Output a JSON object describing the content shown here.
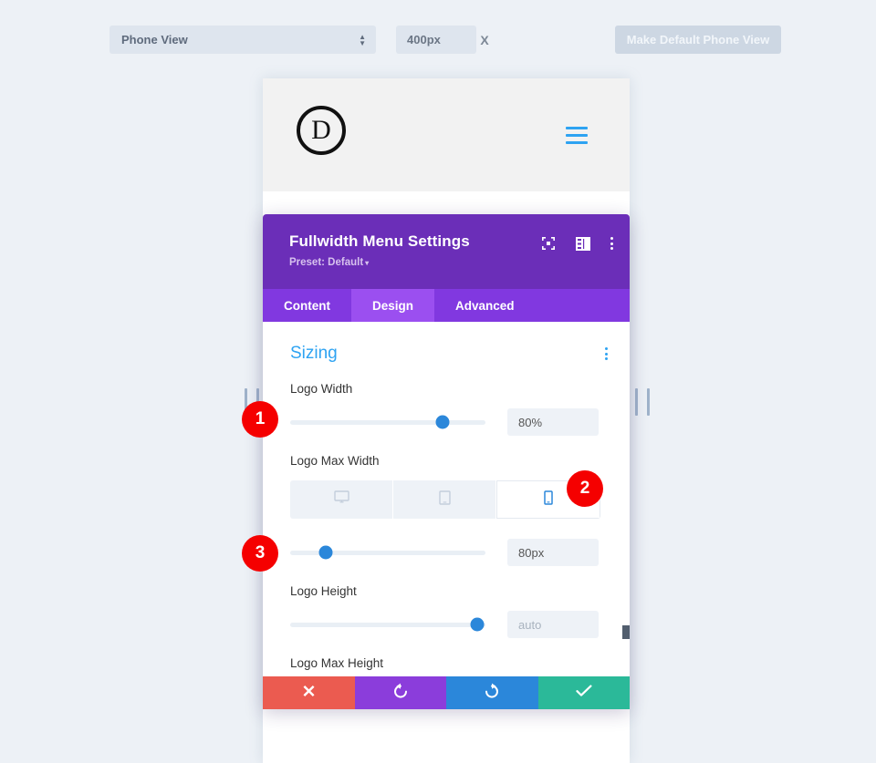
{
  "toolbar": {
    "view_select_value": "Phone View",
    "view_select_icon": "spinner-arrows-icon",
    "width_value": "400px",
    "height_value": "",
    "height_placeholder": "",
    "separator": "X",
    "make_default_label": "Make Default Phone View"
  },
  "preview": {
    "logo_letter": "D",
    "logo_icon": "divi-logo-icon",
    "menu_icon": "hamburger-menu-icon"
  },
  "modal": {
    "title": "Fullwidth Menu Settings",
    "preset_label": "Preset: Default",
    "preset_caret": "▾",
    "header_icons": [
      {
        "name": "expand-fullscreen-icon"
      },
      {
        "name": "panel-layout-icon"
      },
      {
        "name": "more-options-icon"
      }
    ],
    "tabs": [
      {
        "label": "Content",
        "active": false
      },
      {
        "label": "Design",
        "active": true
      },
      {
        "label": "Advanced",
        "active": false
      }
    ],
    "section": {
      "title": "Sizing",
      "options_icon": "section-options-icon"
    },
    "fields": [
      {
        "label": "Logo Width",
        "slider_percent": 78,
        "value": "80%",
        "is_placeholder": false
      },
      {
        "label": "Logo Max Width",
        "slider_percent": 18,
        "value": "80px",
        "is_placeholder": false
      },
      {
        "label": "Logo Height",
        "slider_percent": 96,
        "value": "auto",
        "is_placeholder": true
      },
      {
        "label": "Logo Max Height"
      }
    ],
    "devices": [
      {
        "name": "desktop",
        "icon": "desktop-icon",
        "active": false
      },
      {
        "name": "tablet",
        "icon": "tablet-icon",
        "active": false
      },
      {
        "name": "phone",
        "icon": "phone-icon",
        "active": true
      }
    ],
    "footer_buttons": [
      {
        "name": "cancel-button",
        "icon": "close-x-icon"
      },
      {
        "name": "undo-button",
        "icon": "undo-arrow-icon"
      },
      {
        "name": "redo-button",
        "icon": "redo-arrow-icon"
      },
      {
        "name": "save-button",
        "icon": "checkmark-icon"
      }
    ]
  },
  "annotations": {
    "badges": [
      {
        "number": "1"
      },
      {
        "number": "2"
      },
      {
        "number": "3"
      }
    ]
  },
  "colors": {
    "accent_blue": "#2ea3f2",
    "modal_purple": "#6b2eb8",
    "tab_purple": "#8138e0",
    "tab_active_purple": "#9b4ff0",
    "badge_red": "#f50000",
    "background": "#edf1f6"
  }
}
